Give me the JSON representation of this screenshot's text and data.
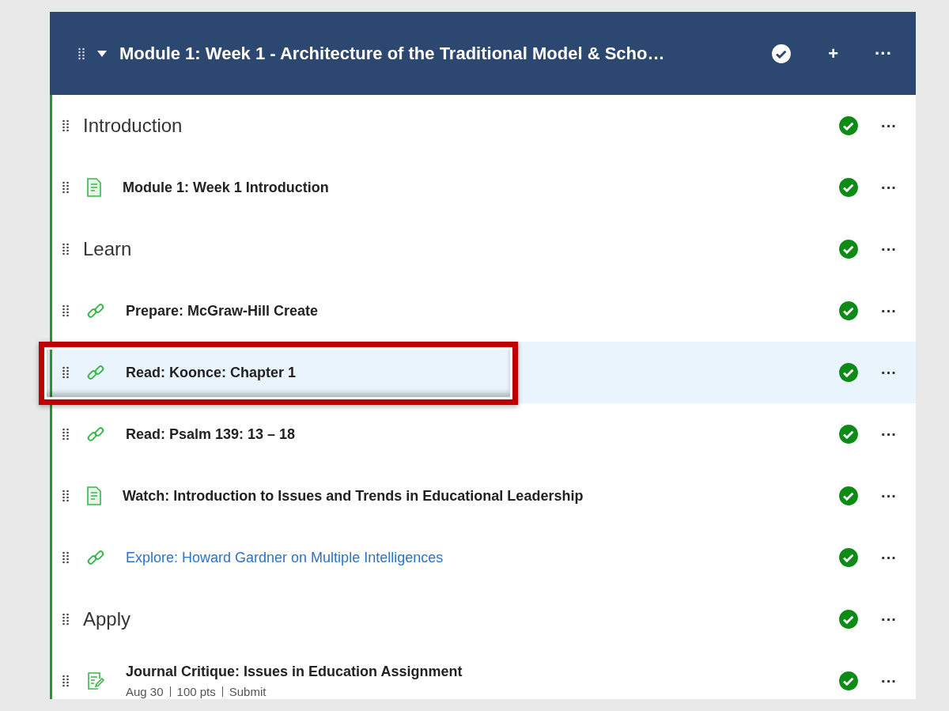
{
  "module": {
    "title": "Module 1: Week 1 - Architecture of the Traditional Model & Scho…",
    "expanded": true,
    "published": true,
    "add": "+",
    "more": "···"
  },
  "items": [
    {
      "kind": "section",
      "title": "Introduction",
      "published": true,
      "highlighted": false,
      "more": "···"
    },
    {
      "kind": "page",
      "title": "Module 1: Week 1 Introduction",
      "published": true,
      "highlighted": false,
      "more": "···"
    },
    {
      "kind": "section",
      "title": "Learn",
      "published": true,
      "highlighted": false,
      "more": "···"
    },
    {
      "kind": "link",
      "title": "Prepare: McGraw-Hill Create",
      "published": true,
      "highlighted": false,
      "more": "···"
    },
    {
      "kind": "link",
      "title": "Read: Koonce: Chapter 1",
      "published": true,
      "highlighted": true,
      "more": "···"
    },
    {
      "kind": "link",
      "title": "Read: Psalm 139: 13 – 18",
      "published": true,
      "highlighted": false,
      "more": "···"
    },
    {
      "kind": "page",
      "title": "Watch: Introduction to Issues and Trends in Educational Leadership",
      "published": true,
      "highlighted": false,
      "more": "···"
    },
    {
      "kind": "link",
      "title": "Explore: Howard Gardner on Multiple Intelligences",
      "is_link": true,
      "published": true,
      "highlighted": false,
      "more": "···"
    },
    {
      "kind": "section",
      "title": "Apply",
      "published": true,
      "highlighted": false,
      "more": "···"
    },
    {
      "kind": "assignment",
      "title": "Journal Critique: Issues in Education Assignment",
      "published": true,
      "highlighted": false,
      "more": "···",
      "meta": [
        "Aug 30",
        "100 pts",
        "Submit"
      ]
    }
  ]
}
